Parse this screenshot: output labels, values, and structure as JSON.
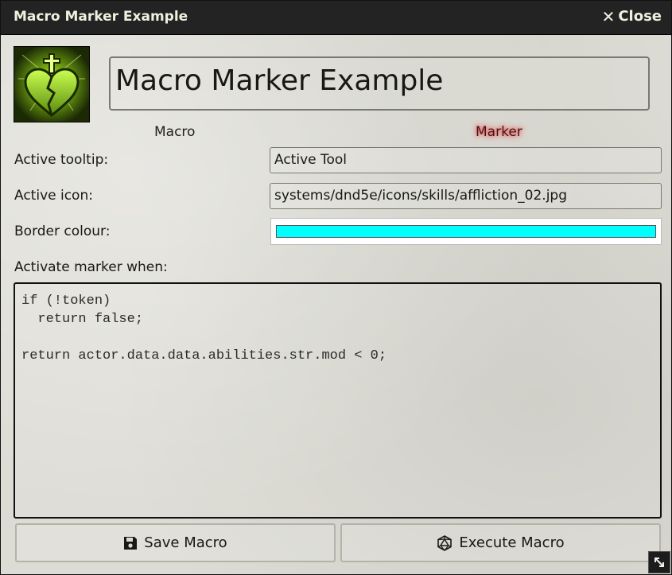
{
  "window": {
    "title": "Macro Marker Example",
    "close_label": "Close"
  },
  "header": {
    "name": "Macro Marker Example"
  },
  "tabs": [
    {
      "label": "Macro",
      "active": false
    },
    {
      "label": "Marker",
      "active": true
    }
  ],
  "form": {
    "tooltip_label": "Active tooltip:",
    "tooltip_value": "Active Tool",
    "icon_label": "Active icon:",
    "icon_value": "systems/dnd5e/icons/skills/affliction_02.jpg",
    "border_label": "Border colour:",
    "border_color": "#00ffff",
    "activate_label": "Activate marker when:",
    "code": "if (!token)\n  return false;\n\nreturn actor.data.data.abilities.str.mod < 0;"
  },
  "buttons": {
    "save_label": "Save Macro",
    "execute_label": "Execute Macro"
  },
  "icons": {
    "close": "close-x-icon",
    "save": "floppy-disk-icon",
    "execute": "d20-dice-icon",
    "resize": "resize-handle-icon",
    "macro_image": "broken-heart-cross-icon"
  }
}
